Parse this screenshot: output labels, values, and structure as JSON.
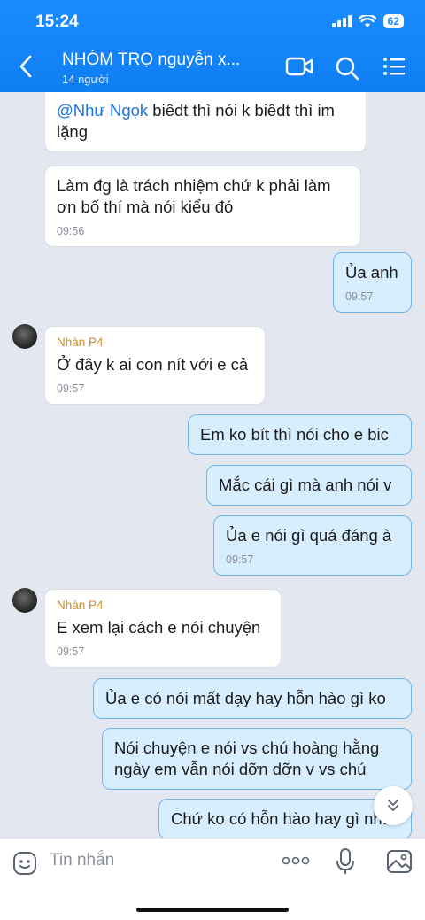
{
  "status": {
    "time": "15:24",
    "battery": "62"
  },
  "header": {
    "title": "NHÓM TRỌ nguyễn x...",
    "subtitle": "14 người"
  },
  "messages": [
    {
      "mention": "@Như Ngọk",
      "text": " biêdt thì nói k biêdt thì im lặng"
    },
    {
      "text": "Làm đg là trách nhiệm chứ k phải làm ơn bố thí mà nói kiểu đó",
      "time": "09:56"
    },
    {
      "text": "Ủa anh",
      "time": "09:57"
    },
    {
      "sender": "Nhàn P4",
      "text": "Ở đây k ai con nít với e cả",
      "time": "09:57"
    },
    {
      "text": "Em ko bít thì nói cho e bic"
    },
    {
      "text": "Mắc cái gì mà anh nói v"
    },
    {
      "text": "Ủa e nói gì quá đáng à",
      "time": "09:57"
    },
    {
      "sender": "Nhàn P4",
      "text": "E xem lại cách e nói chuyện",
      "time": "09:57"
    },
    {
      "text": "Ủa e có nói mất dạy hay hỗn hào gì ko"
    },
    {
      "text": "Nói chuyện e nói vs chú hoàng hằng ngày em vẫn nói dỡn dỡn v vs chú"
    },
    {
      "text": "Chứ ko có hỗn hào hay gì nha"
    }
  ],
  "composer": {
    "placeholder": "Tin nhắn"
  },
  "icons": {
    "back": "chevron-left-icon",
    "video": "video-call-icon",
    "search": "search-icon",
    "menu": "list-menu-icon",
    "emoji": "emoji-icon",
    "more": "more-dots-icon",
    "mic": "microphone-icon",
    "image": "image-icon",
    "scroll": "chevron-double-down-icon"
  },
  "colors": {
    "header": "#1a8cff",
    "outgoing": "#d7eeff",
    "incoming": "#ffffff",
    "sender": "#c8922a",
    "mention": "#1a73e8"
  }
}
